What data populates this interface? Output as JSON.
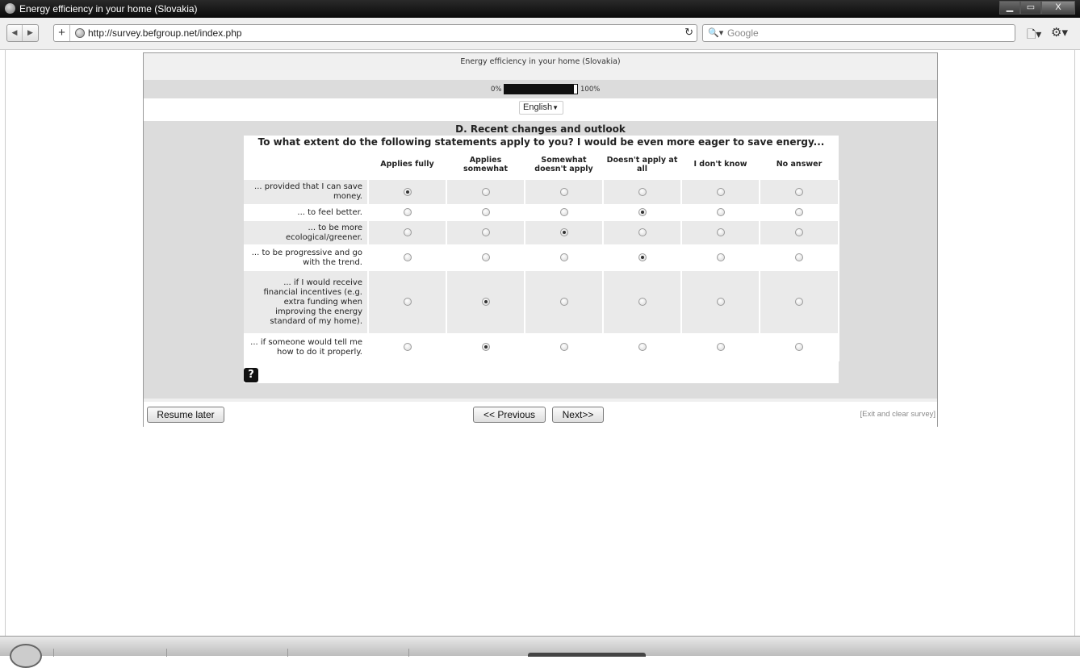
{
  "window": {
    "title": "Energy efficiency in your home (Slovakia)",
    "controls": [
      "▁",
      "▭",
      "X"
    ]
  },
  "browser": {
    "url": "http://survey.befgroup.net/index.php",
    "search_placeholder": "Google",
    "back_icon": "back-arrow-icon",
    "forward_icon": "forward-arrow-icon"
  },
  "survey": {
    "title": "Energy efficiency in your home (Slovakia)",
    "progress": {
      "label_start": "0%",
      "label_end": "100%",
      "value": 0.95
    },
    "language": "English",
    "group_title": "D. Recent changes and outlook",
    "question": "To what extent do the following statements apply to you? I would be even more eager to save energy...",
    "columns": [
      "Applies fully",
      "Applies somewhat",
      "Somewhat doesn't apply",
      "Doesn't apply at all",
      "I don't know",
      "No answer"
    ],
    "rows": [
      {
        "label": "... provided that I can save money.",
        "selected": 0
      },
      {
        "label": "... to feel better.",
        "selected": 3
      },
      {
        "label": "... to be more ecological/greener.",
        "selected": 2
      },
      {
        "label": "... to be progressive and go with the trend.",
        "selected": 3
      },
      {
        "label": "... if I would receive financial incentives (e.g. extra funding when improving the energy standard of my home).",
        "selected": 1
      },
      {
        "label": "... if someone would tell me how to do it properly.",
        "selected": 1
      }
    ],
    "help_label": "?",
    "buttons": {
      "resume": "Resume later",
      "previous": "<< Previous",
      "next": "Next>>"
    },
    "exit_link": "[Exit and clear survey]"
  }
}
